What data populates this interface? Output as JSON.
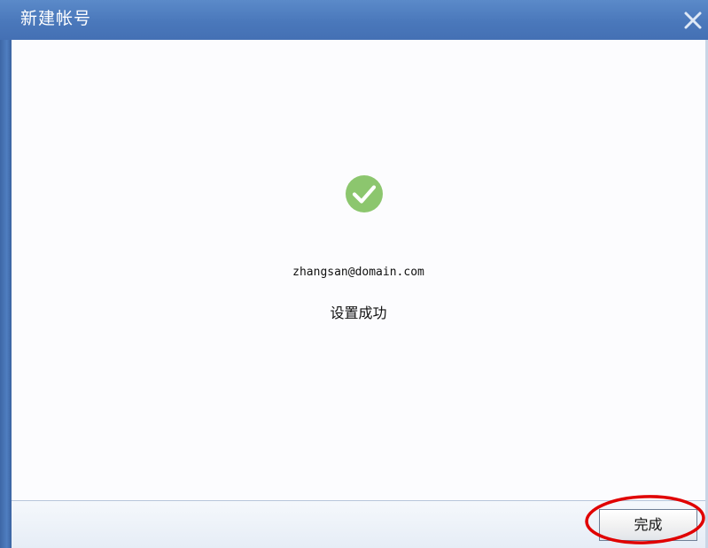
{
  "dialog": {
    "title": "新建帐号",
    "close_icon": "close-icon",
    "title_color": "#ffffff",
    "titlebar_color": "#4a78bb"
  },
  "main": {
    "icon": "success-check-icon",
    "icon_color": "#8cc66e",
    "account_email": "zhangsan@domain.com",
    "status_message": "设置成功"
  },
  "footer": {
    "finish_label": "完成"
  },
  "annotation": {
    "shape": "red-ellipse-around-finish-button",
    "color": "#e00000"
  }
}
